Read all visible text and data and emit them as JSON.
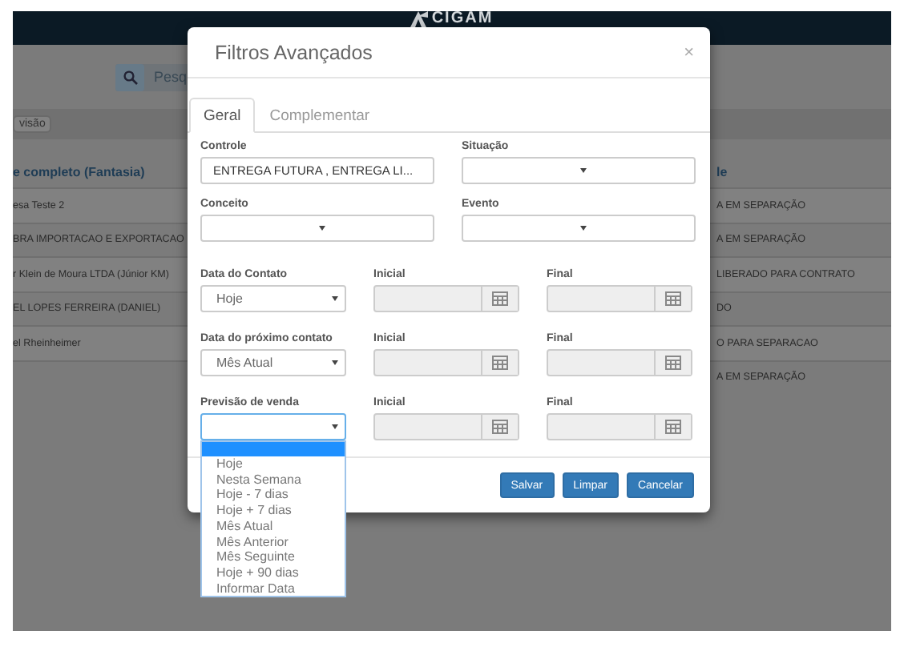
{
  "app": {
    "logo": "CIGAM",
    "search_text": "Pesq",
    "view_chip": "visão",
    "columns": [
      "e completo (Fantasia)",
      "le"
    ],
    "rows": [
      {
        "column_1": "esa Teste 2",
        "column_2": "A EM SEPARAÇÃO"
      },
      {
        "column_1": "BRA IMPORTACAO E EXPORTACAO",
        "column_2": "A EM SEPARAÇÃO"
      },
      {
        "column_1": "r Klein de Moura LTDA (Júnior KM)",
        "column_2": "LIBERADO PARA CONTRATO"
      },
      {
        "column_1": "EL LOPES FERREIRA (DANIEL)",
        "column_2": "DO"
      },
      {
        "column_1": "el Rheinheimer",
        "column_2": "O PARA SEPARACAO"
      },
      {
        "column_2": "A EM SEPARAÇÃO"
      }
    ]
  },
  "modal": {
    "title": "Filtros Avançados",
    "close": "×",
    "tabs": [
      {
        "label": "Geral",
        "selected": true
      },
      {
        "label": "Complementar",
        "selected": false
      }
    ],
    "fields": [
      {
        "label": "Controle",
        "kind": "text",
        "value": "ENTREGA FUTURA , ENTREGA LI..."
      },
      {
        "label": "Situação",
        "kind": "select"
      },
      {
        "label": "Conceito",
        "kind": "select"
      },
      {
        "label": "Evento",
        "kind": "select"
      }
    ],
    "date_rows": [
      {
        "label": "Data do Contato",
        "value": "Hoje",
        "focused": false,
        "start": {
          "label": "Inicial",
          "disabled": true
        },
        "end": {
          "label": "Final",
          "disabled": true
        }
      },
      {
        "label": "Data do próximo contato",
        "value": "Mês Atual",
        "focused": false,
        "start": {
          "label": "Inicial",
          "disabled": true
        },
        "end": {
          "label": "Final",
          "disabled": true
        }
      },
      {
        "label": "Previsão de venda",
        "focused": true,
        "open": true,
        "start": {
          "label": "Inicial",
          "disabled": true
        },
        "end": {
          "label": "Final",
          "disabled": true
        }
      }
    ],
    "dropdown": {
      "blank_highlighted": true,
      "options": [
        {
          "label": "Hoje",
          "selected": false
        },
        {
          "label": "Nesta Semana",
          "selected": false
        },
        {
          "label": "Hoje - 7 dias",
          "selected": false
        },
        {
          "label": "Hoje + 7 dias",
          "selected": false
        },
        {
          "label": "Mês Atual",
          "selected": false
        },
        {
          "label": "Mês Anterior",
          "selected": false
        },
        {
          "label": "Mês Seguinte",
          "selected": false
        },
        {
          "label": "Hoje + 90 dias",
          "selected": false
        },
        {
          "label": "Informar Data",
          "selected": false
        }
      ]
    },
    "buttons": [
      "Salvar",
      "Limpar",
      "Cancelar"
    ]
  }
}
